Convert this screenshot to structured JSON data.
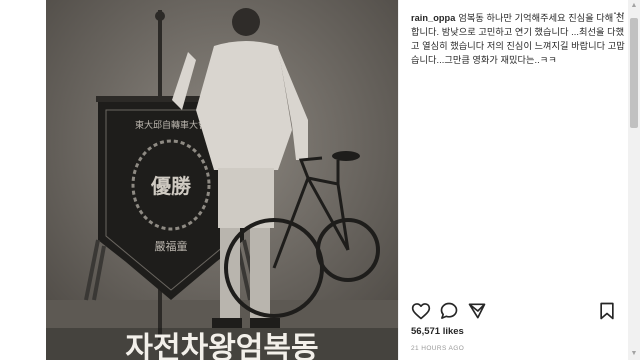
{
  "post": {
    "username": "rain_oppa",
    "caption": "엄복동 하나만 기억해주세요 진심을 다해 전합니다. 밤낮으로 고민하고 연기 했습니다 ...최선을 다했고 열심히 했습니다 저의 진심이 느껴지길 바랍니다 고맙습니다...그만큼 영화가 재밌다는..ㅋㅋ",
    "likes": "56,571 likes",
    "timestamp": "21 HOURS AGO"
  },
  "poster": {
    "banner_top": "東大邱自轉車大會",
    "banner_winner": "優勝",
    "banner_bottom": "嚴福童",
    "title": "자전차왕엄복동"
  },
  "icons": {
    "more": "more-options-icon",
    "like": "heart-icon",
    "comment": "comment-icon",
    "share": "share-icon",
    "save": "bookmark-icon"
  },
  "colors": {
    "text": "#262626",
    "muted": "#999999",
    "poster_bg": "#77726b"
  }
}
